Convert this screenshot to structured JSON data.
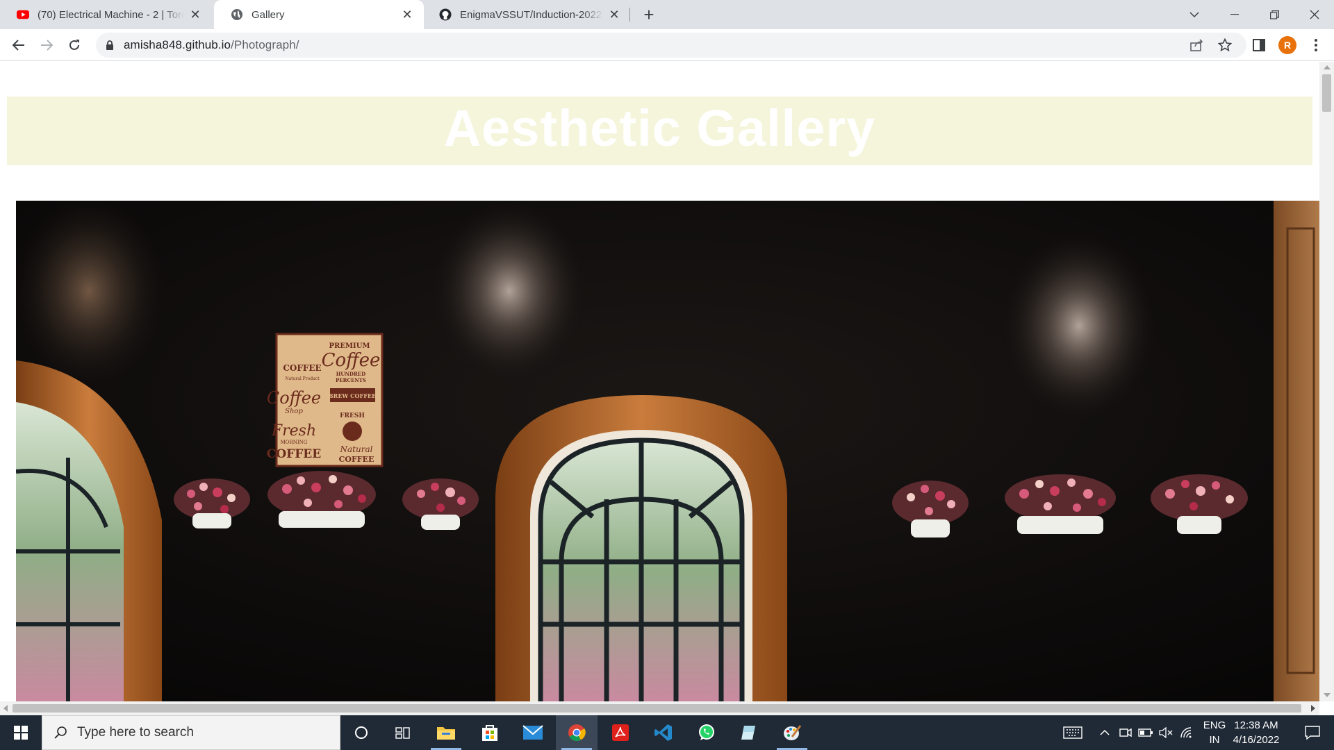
{
  "browser": {
    "tabs": [
      {
        "title": "(70) Electrical Machine - 2 | Torque",
        "favicon": "youtube-icon",
        "active": false
      },
      {
        "title": "Gallery",
        "favicon": "globe-icon",
        "active": true
      },
      {
        "title": "EnigmaVSSUT/Induction-2022: Enigma",
        "favicon": "github-icon",
        "active": false
      }
    ],
    "address": {
      "host": "amisha848.github.io",
      "path": "/Photograph/"
    },
    "profile_initial": "R"
  },
  "page": {
    "heading": "Aesthetic Gallery",
    "heading_bg": "#f5f5dc",
    "photo": {
      "description": "cafe interior with dark wall, arched windows, spotlights, coffee poster and flower pots",
      "poster": {
        "premium": "PREMIUM",
        "coffee_script": "Coffee",
        "hundred": "HUNDRED",
        "percents": "PERCENTS",
        "coffee_label": "COFFEE",
        "natural_product": "Natural Product",
        "coffee_shop_script": "Coffee",
        "shop_script": "Shop",
        "brew_coffee": "BREW COFFEE",
        "fresh_band": "FRESH",
        "fresh_script": "Fresh",
        "morning": "MORNING",
        "coffee_tall": "COFFEE",
        "natural_script": "Natural",
        "coffee_bottom": "COFFEE"
      }
    }
  },
  "taskbar": {
    "search_placeholder": "Type here to search",
    "language": [
      "ENG",
      "IN"
    ],
    "time": "12:38 AM",
    "date": "4/16/2022",
    "pinned": [
      "cortana-icon",
      "task-view-icon",
      "file-explorer-icon",
      "store-icon",
      "mail-icon",
      "chrome-icon",
      "acrobat-icon",
      "vscode-icon",
      "whatsapp-icon",
      "notes-icon",
      "paint-icon"
    ]
  }
}
